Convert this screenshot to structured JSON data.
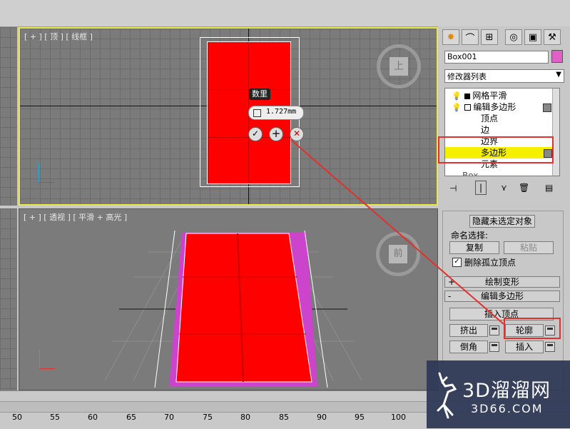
{
  "viewport_top": {
    "label": "[ + ] [ 顶 ] [ 线框 ]"
  },
  "viewport_persp": {
    "label": "[ + ] [ 透视 ] [ 平滑 + 高光 ]"
  },
  "viewcube_top": {
    "face": "上"
  },
  "viewcube_persp": {
    "face": "前"
  },
  "caddy": {
    "title": "数里",
    "value": "1.727mm"
  },
  "command_panel": {
    "object_name": "Box001",
    "object_color": "#e060c8",
    "modifier_list": "修改器列表",
    "stack": [
      {
        "label": "网格平滑",
        "level": 0
      },
      {
        "label": "编辑多边形",
        "level": 0
      },
      {
        "label": "顶点",
        "level": 1
      },
      {
        "label": "边",
        "level": 1
      },
      {
        "label": "边界",
        "level": 1
      },
      {
        "label": "多边形",
        "level": 1,
        "selected": true
      },
      {
        "label": "元素",
        "level": 1
      },
      {
        "label": "Box",
        "level": 0
      }
    ],
    "hide_unselected": "隐藏未选定对象",
    "named_selection": "命名选择:",
    "copy": "复制",
    "paste": "粘贴",
    "delete_isolated": "删除孤立顶点",
    "paint_deform": "绘制变形",
    "edit_polygons": "编辑多边形",
    "insert_vertex": "插入顶点",
    "extrude": "挤出",
    "outline": "轮廓",
    "bevel": "倒角",
    "inset": "插入"
  },
  "timeline": {
    "ticks": [
      "50",
      "55",
      "60",
      "65",
      "70",
      "75",
      "80",
      "85",
      "90",
      "95",
      "100"
    ]
  },
  "watermark": {
    "brand": "3D溜溜网",
    "url": "3D66.COM"
  },
  "colors": {
    "highlight": "#f4f000",
    "object_red": "#ff0000",
    "callout_red": "#e0322c",
    "active_border": "#e8e84a"
  }
}
